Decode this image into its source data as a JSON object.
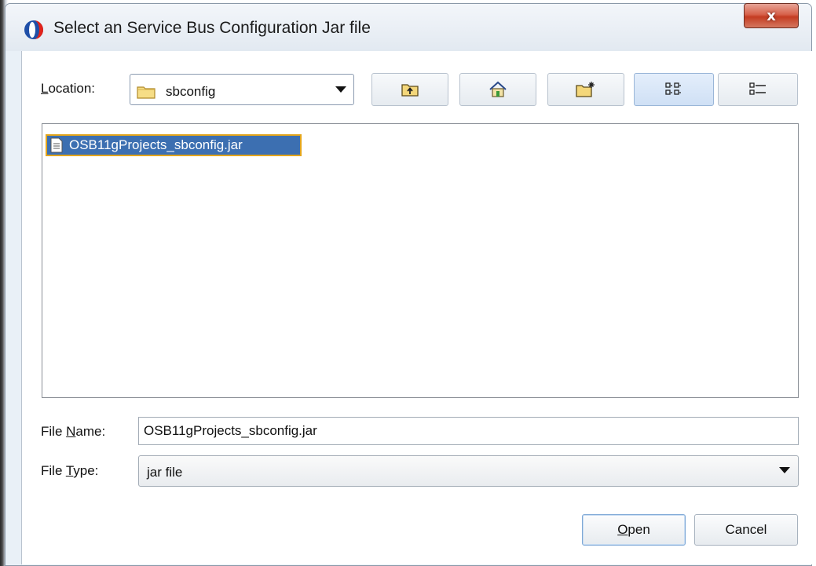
{
  "window": {
    "title": "Select an Service Bus Configuration Jar file",
    "close_label": "x"
  },
  "location": {
    "label": "Location:",
    "label_mnemonic": "L",
    "label_rest": "ocation:",
    "value": "sbconfig"
  },
  "toolbar": {
    "buttons": [
      {
        "name": "up-one-level",
        "icon": "folder-up-icon"
      },
      {
        "name": "home",
        "icon": "home-icon"
      },
      {
        "name": "new-folder",
        "icon": "new-folder-icon"
      },
      {
        "name": "list-view",
        "icon": "list-view-icon",
        "active": true
      },
      {
        "name": "details-view",
        "icon": "details-view-icon"
      }
    ]
  },
  "files": [
    {
      "name": "OSB11gProjects_sbconfig.jar",
      "icon": "document-icon",
      "selected": true
    }
  ],
  "file_name": {
    "label_pre": "File ",
    "label_mnemonic": "N",
    "label_post": "ame:",
    "value": "OSB11gProjects_sbconfig.jar"
  },
  "file_type": {
    "label_pre": "File ",
    "label_mnemonic": "T",
    "label_post": "ype:",
    "value": "jar file"
  },
  "buttons": {
    "open_mnemonic": "O",
    "open_rest": "pen",
    "cancel": "Cancel"
  },
  "colors": {
    "selection": "#3c6fb1",
    "selection_border": "#e3a51c",
    "close_button": "#c43c22"
  }
}
